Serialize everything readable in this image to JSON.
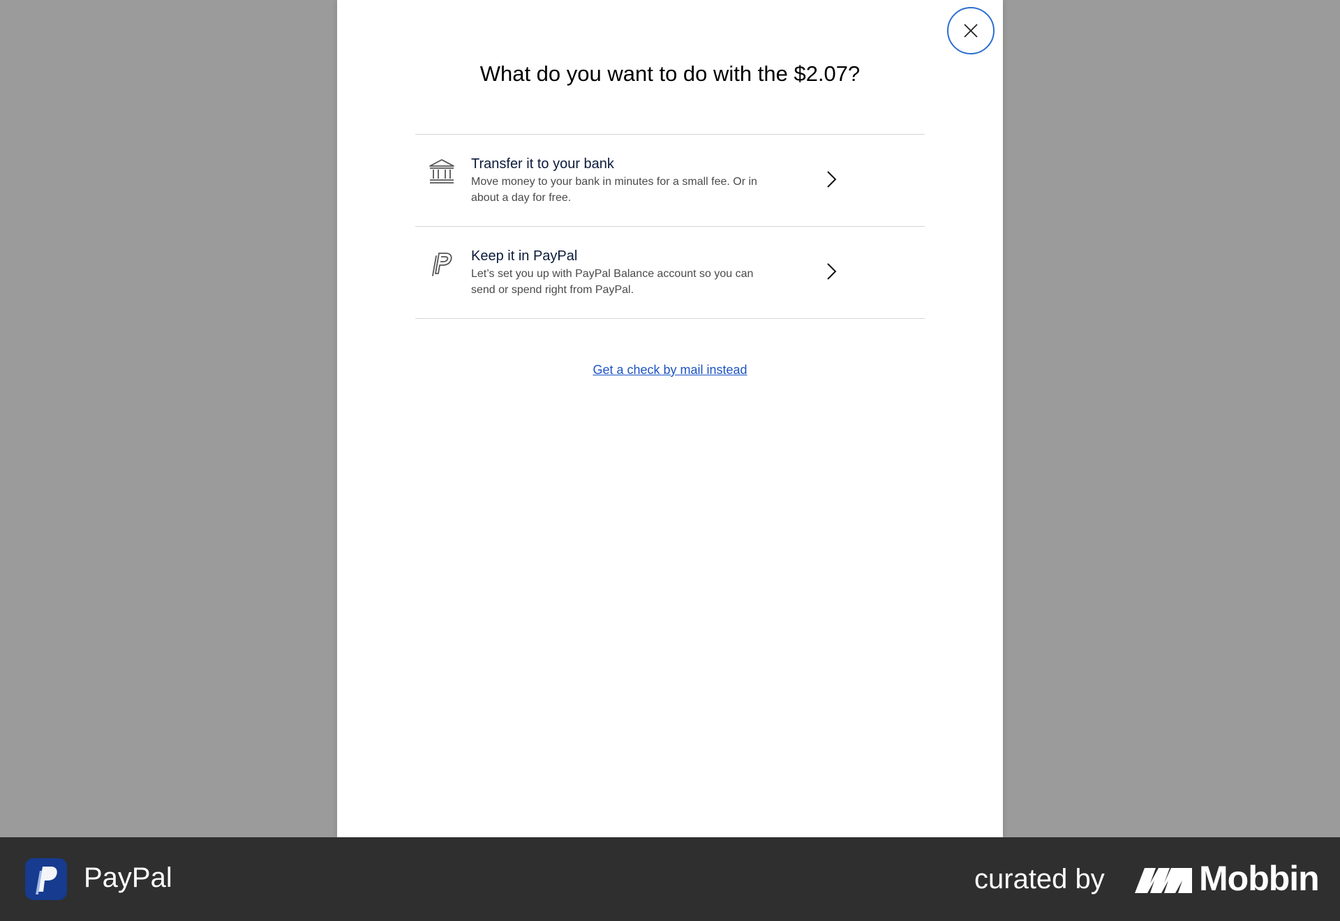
{
  "modal": {
    "title": "What do you want to do with the $2.07?",
    "close_icon": "close-icon",
    "options": [
      {
        "icon": "bank-icon",
        "title": "Transfer it to your bank",
        "description": "Move money to your bank in minutes for a small fee. Or in about a day for free."
      },
      {
        "icon": "paypal-icon",
        "title": "Keep it in PayPal",
        "description": "Let’s set you up with PayPal Balance account so you can send or spend right from PayPal."
      }
    ],
    "check_link": "Get a check by mail instead"
  },
  "footer": {
    "app_name": "PayPal",
    "curated_by": "curated by",
    "brand": "Mobbin"
  },
  "colors": {
    "backdrop": "#9b9b9b",
    "accent": "#2c6fd1",
    "link": "#1d54c4",
    "footer_bg": "#2f2f2f"
  }
}
